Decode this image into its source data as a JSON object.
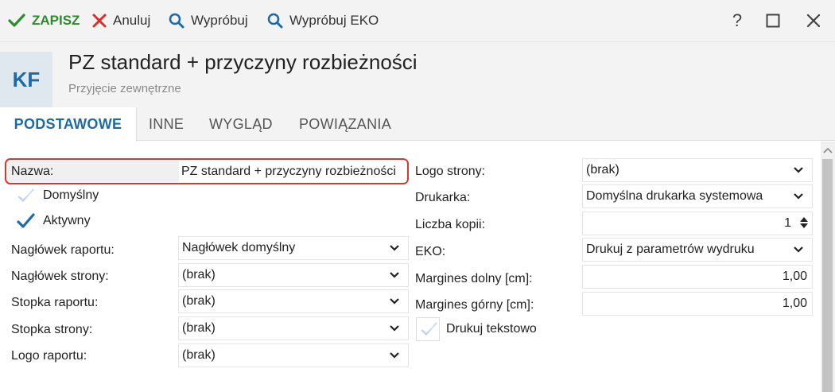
{
  "toolbar": {
    "save_label": "ZAPISZ",
    "cancel_label": "Anuluj",
    "try_label": "Wypróbuj",
    "try_eko_label": "Wypróbuj EKO",
    "help_label": "?"
  },
  "header": {
    "avatar_initials": "KF",
    "title": "PZ standard + przyczyny rozbieżności",
    "subtitle": "Przyjęcie zewnętrzne"
  },
  "tabs": [
    {
      "label": "PODSTAWOWE",
      "active": true
    },
    {
      "label": "INNE",
      "active": false
    },
    {
      "label": "WYGLĄD",
      "active": false
    },
    {
      "label": "POWIĄZANIA",
      "active": false
    }
  ],
  "left": {
    "name_label": "Nazwa:",
    "name_value": "PZ standard + przyczyny rozbieżności",
    "default_label": "Domyślny",
    "default_checked": false,
    "active_label": "Aktywny",
    "active_checked": true,
    "fields": [
      {
        "label": "Nagłówek raportu:",
        "value": "Nagłówek domyślny"
      },
      {
        "label": "Nagłówek strony:",
        "value": "(brak)"
      },
      {
        "label": "Stopka raportu:",
        "value": "(brak)"
      },
      {
        "label": "Stopka strony:",
        "value": "(brak)"
      },
      {
        "label": "Logo raportu:",
        "value": "(brak)"
      }
    ]
  },
  "right": {
    "page_logo_label": "Logo strony:",
    "page_logo_value": "(brak)",
    "printer_label": "Drukarka:",
    "printer_value": "Domyślna drukarka systemowa",
    "copies_label": "Liczba kopii:",
    "copies_value": "1",
    "eko_label": "EKO:",
    "eko_value": "Drukuj z parametrów wydruku",
    "margin_bottom_label": "Margines dolny [cm]:",
    "margin_bottom_value": "1,00",
    "margin_top_label": "Margines górny [cm]:",
    "margin_top_value": "1,00",
    "text_print_label": "Drukuj tekstowo",
    "text_print_checked": false
  },
  "colors": {
    "accent": "#1f6aa5",
    "save_green": "#2e8b2e",
    "cancel_red": "#d9302c",
    "highlight_red": "#e0342f"
  }
}
